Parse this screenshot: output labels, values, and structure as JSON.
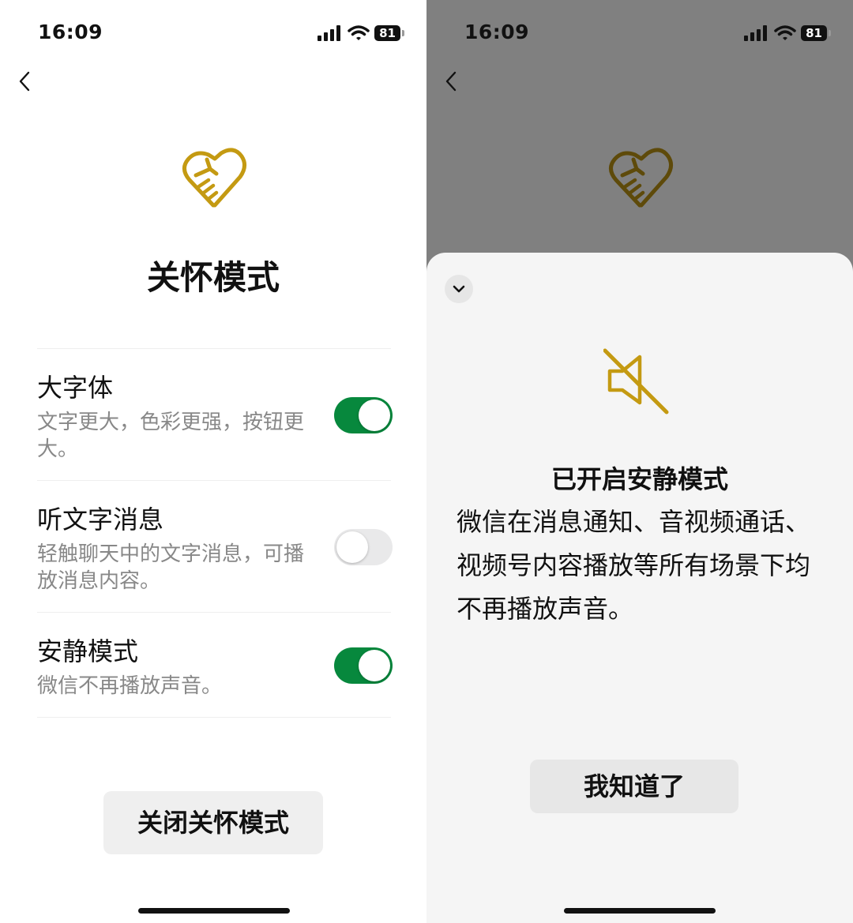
{
  "left_screen": {
    "status": {
      "time": "16:09",
      "battery": "81"
    },
    "title": "关怀模式",
    "settings": [
      {
        "title": "大字体",
        "desc": "文字更大，色彩更强，按钮更大。",
        "enabled": true
      },
      {
        "title": "听文字消息",
        "desc": "轻触聊天中的文字消息，可播放消息内容。",
        "enabled": false
      },
      {
        "title": "安静模式",
        "desc": "微信不再播放声音。",
        "enabled": true
      }
    ],
    "close_button": "关闭关怀模式"
  },
  "right_screen": {
    "status": {
      "time": "16:09",
      "battery": "81"
    },
    "sheet": {
      "title": "已开启安静模式",
      "body": "微信在消息通知、音视频通话、视频号内容播放等所有场景下均不再播放声音。",
      "ok_button": "我知道了"
    }
  },
  "colors": {
    "accent_gold": "#c49a12",
    "toggle_on": "#07883d",
    "toggle_off": "#e9e9ea",
    "dim_overlay": "#808080"
  },
  "icons": [
    "back-chevron-icon",
    "care-heart-hand-icon",
    "signal-icon",
    "wifi-icon",
    "battery-icon",
    "chevron-down-icon",
    "mute-speaker-icon"
  ]
}
